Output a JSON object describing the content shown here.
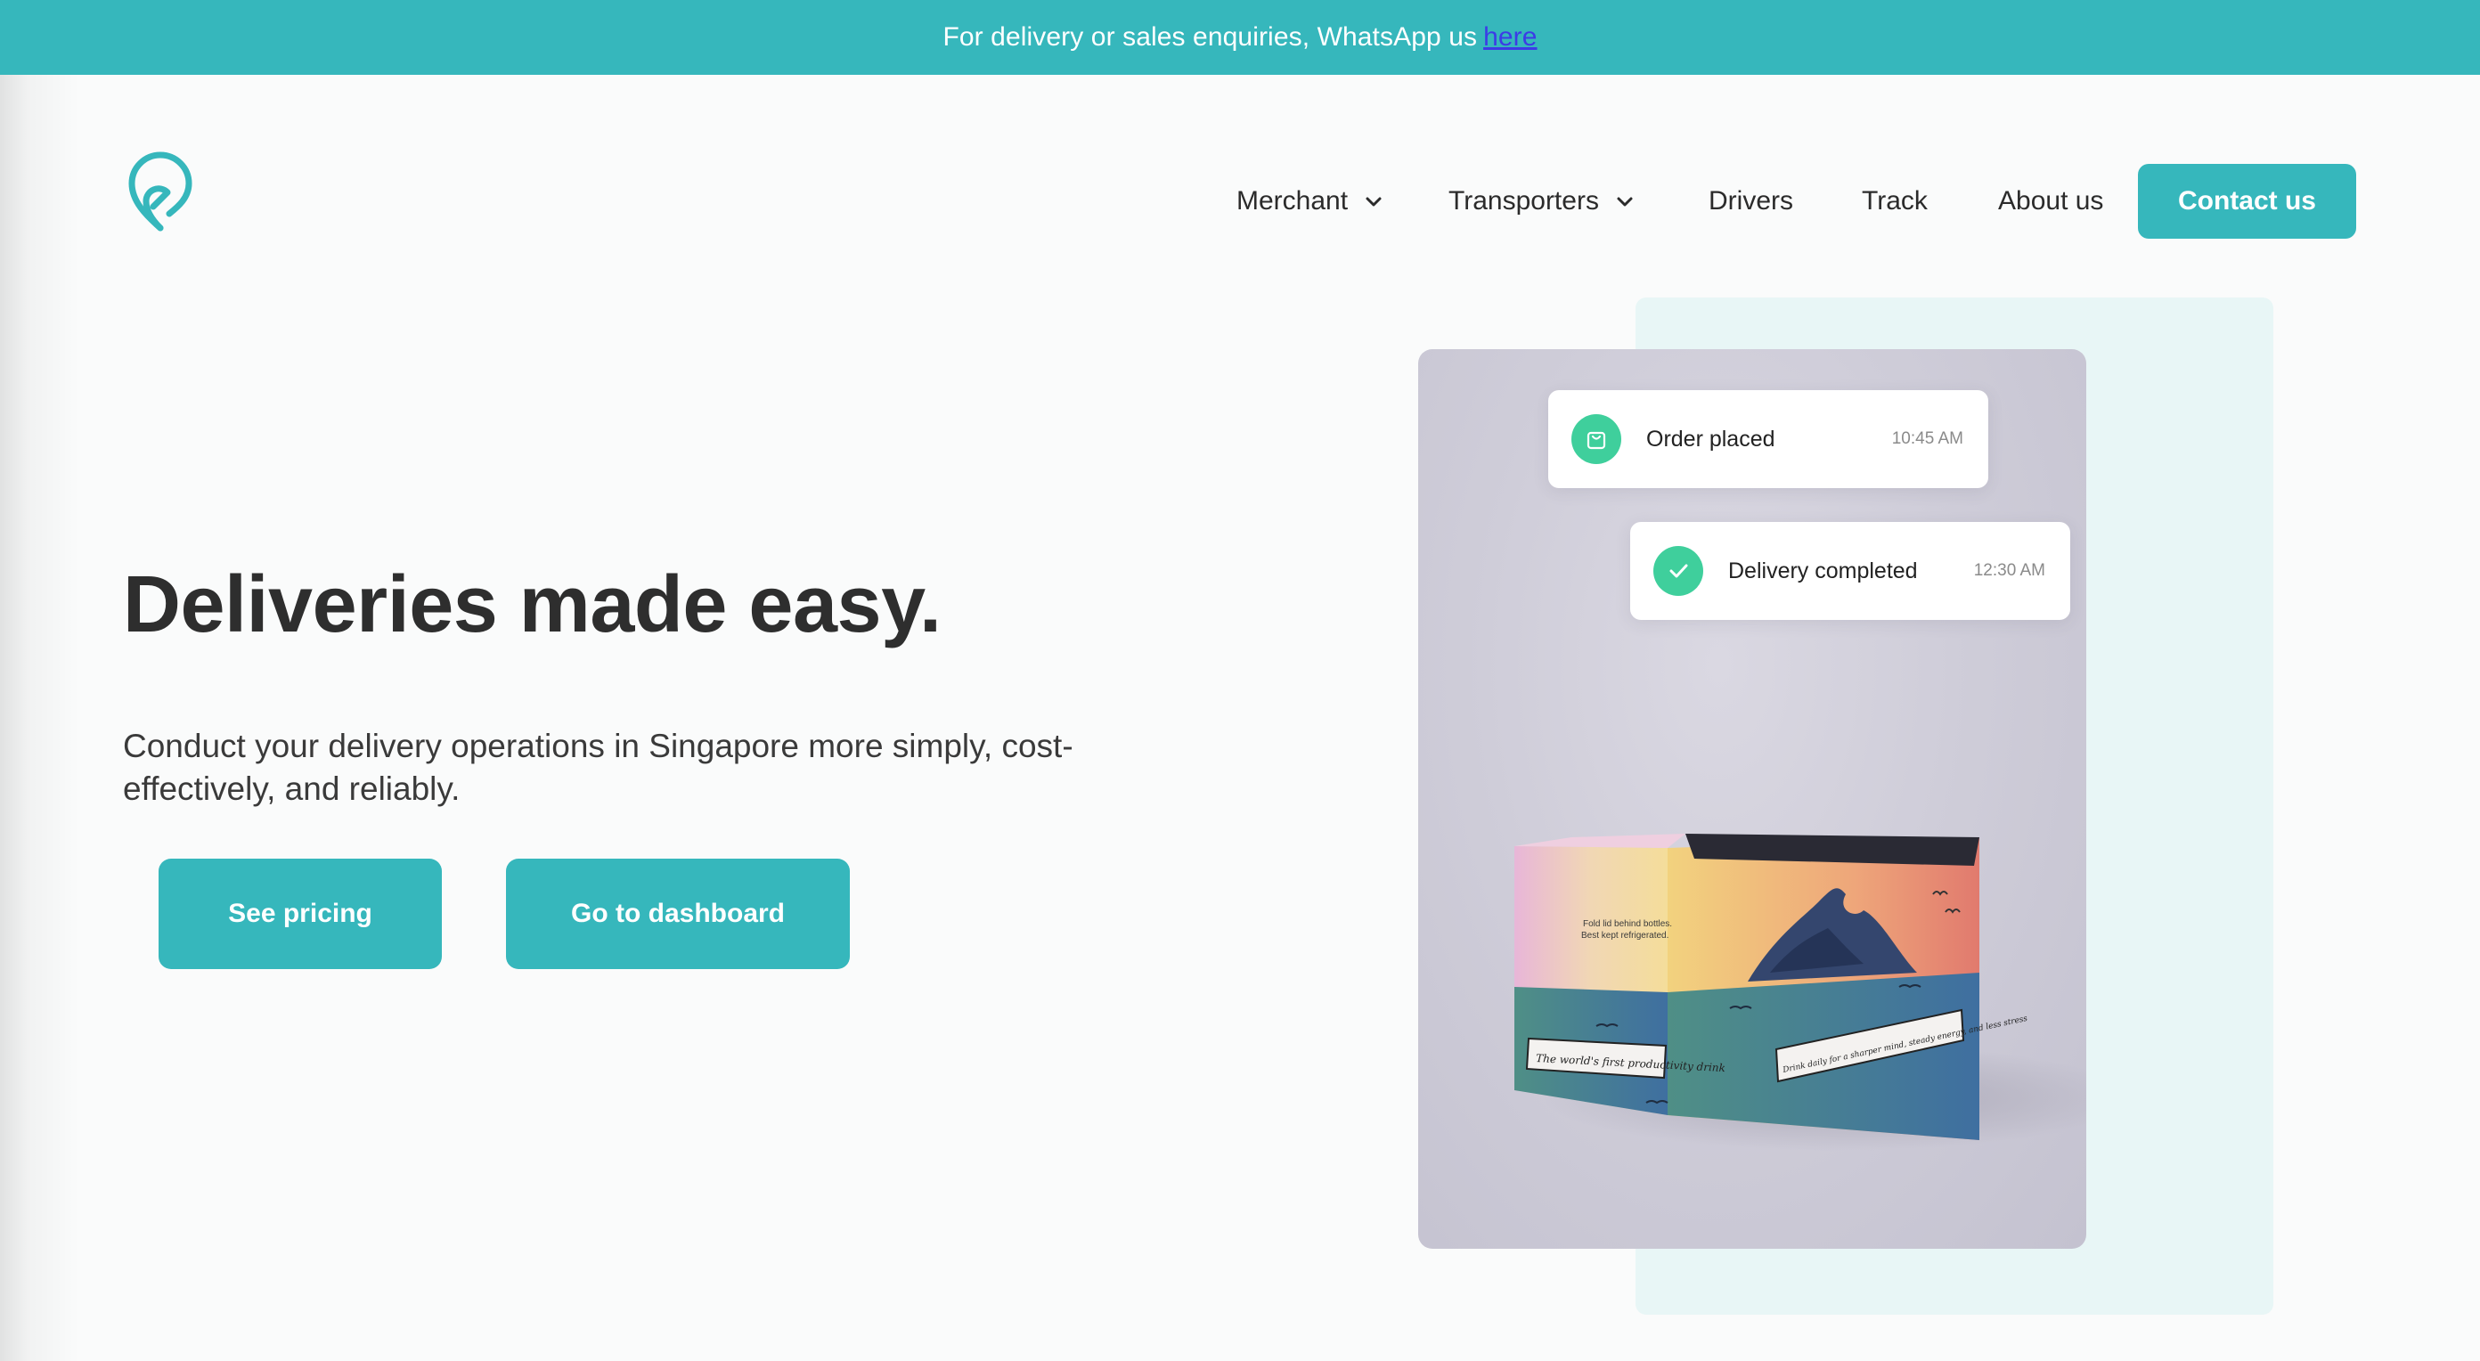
{
  "announcement": {
    "text": "For delivery or sales enquiries, WhatsApp us",
    "link_label": "here"
  },
  "header": {
    "nav": [
      {
        "label": "Merchant",
        "has_dropdown": true
      },
      {
        "label": "Transporters",
        "has_dropdown": true
      },
      {
        "label": "Drivers",
        "has_dropdown": false
      },
      {
        "label": "Track",
        "has_dropdown": false
      },
      {
        "label": "About us",
        "has_dropdown": false
      }
    ],
    "contact_label": "Contact us"
  },
  "hero": {
    "title": "Deliveries made easy.",
    "subtitle": "Conduct your delivery operations in Singapore more simply, cost-effectively, and reliably.",
    "primary_button": "See pricing",
    "secondary_button": "Go to dashboard"
  },
  "status_cards": [
    {
      "label": "Order placed",
      "time": "10:45 AM",
      "icon": "shopping-bag-icon"
    },
    {
      "label": "Delivery completed",
      "time": "12:30 AM",
      "icon": "check-icon"
    }
  ],
  "product_box": {
    "lid_text_line1": "Fold lid behind bottles.",
    "lid_text_line2": "Best kept refrigerated.",
    "front_label": "The world's first productivity drink",
    "side_label": "Drink daily for a sharper mind, steady energy, and less stress"
  },
  "colors": {
    "brand": "#36b7bc",
    "success": "#3fcf9c",
    "panel": "#e8f6f6",
    "link": "#3c3ce6"
  }
}
